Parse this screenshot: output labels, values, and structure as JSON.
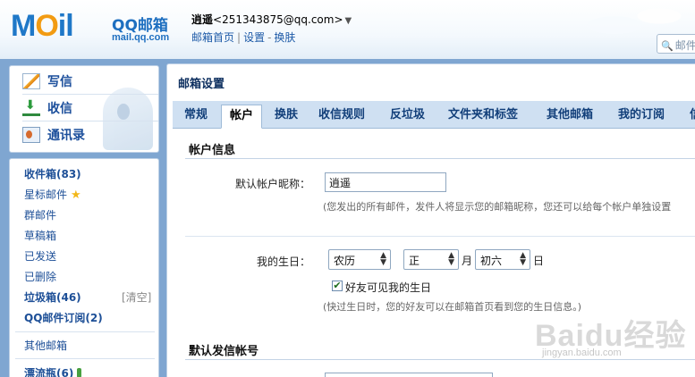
{
  "header": {
    "logo_word": "MOil",
    "logo_brand": "QQ邮箱",
    "logo_url": "mail.qq.com",
    "user_name": "逍遥",
    "user_email": "<251343875@qq.com>",
    "dropdown_glyph": "▼",
    "link_home": "邮箱首页",
    "link_settings": "设置",
    "link_skin": "换肤",
    "link_sep": "|",
    "link_dash": "-",
    "search_placeholder": "邮件"
  },
  "sidebar": {
    "quick": [
      {
        "label": "写信",
        "icon": "write-icon"
      },
      {
        "label": "收信",
        "icon": "inbox-download-icon"
      },
      {
        "label": "通讯录",
        "icon": "contacts-icon"
      }
    ],
    "folders": [
      {
        "label": "收件箱(83)",
        "strong": true
      },
      {
        "label": "星标邮件",
        "strong": false,
        "icon": "star-icon",
        "icon_glyph": "★"
      },
      {
        "label": "群邮件",
        "strong": false
      },
      {
        "label": "草稿箱",
        "strong": false
      },
      {
        "label": "已发送",
        "strong": false
      },
      {
        "label": "已删除",
        "strong": false
      },
      {
        "label": "垃圾箱(46)",
        "strong": true,
        "action": "[清空]"
      },
      {
        "label": "QQ邮件订阅(2)",
        "strong": true
      }
    ],
    "other_mailbox": "其他邮箱",
    "drift_bottle": "漂流瓶(6)"
  },
  "main": {
    "title": "邮箱设置",
    "tabs": [
      "常规",
      "帐户",
      "换肤",
      "收信规则",
      "反垃圾",
      "文件夹和标签",
      "其他邮箱",
      "我的订阅",
      "信"
    ],
    "active_tab": "帐户",
    "account_section": {
      "title": "帐户信息",
      "nickname_label": "默认帐户昵称：",
      "nickname_value": "逍遥",
      "nickname_hint": "(您发出的所有邮件，发件人将显示您的邮箱昵称，您还可以给每个帐户单独设置"
    },
    "birthday": {
      "label": "我的生日：",
      "calendar": "农历",
      "month": "正",
      "month_unit": "月",
      "day": "初六",
      "day_unit": "日",
      "friends_visible": "好友可见我的生日",
      "checked": true,
      "check_glyph": "✔",
      "hint": "(快过生日时，您的好友可以在邮箱首页看到您的生日信息。)"
    },
    "sender_section": {
      "title": "默认发信帐号"
    }
  },
  "watermark": {
    "main": "Baidu经验",
    "sub": "jingyan.baidu.com"
  }
}
